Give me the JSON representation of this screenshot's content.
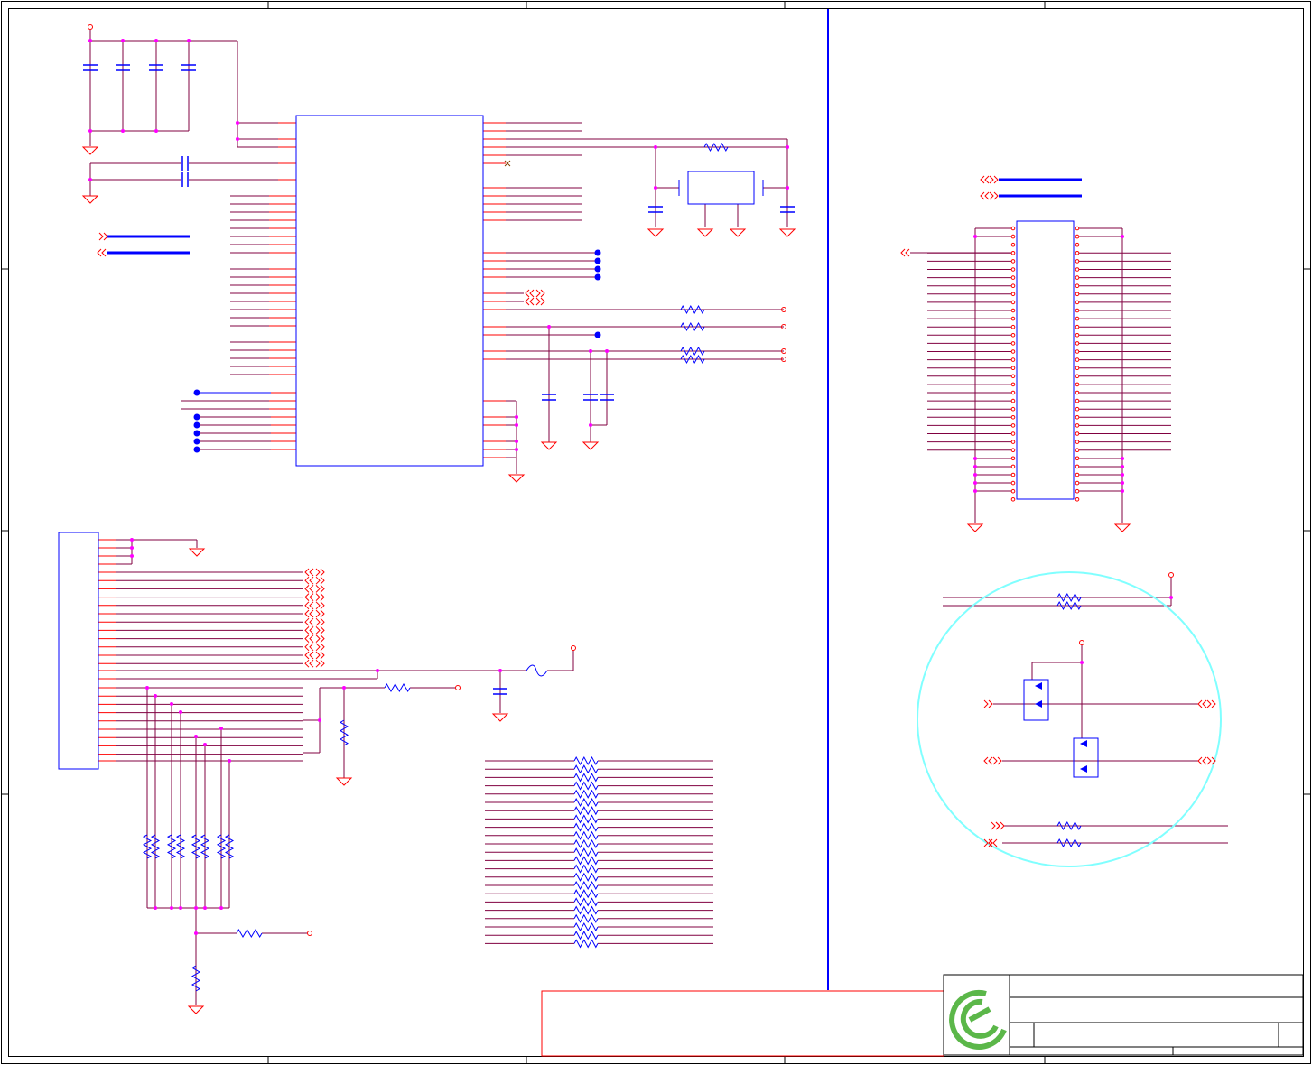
{
  "sheet": {
    "type": "schematic",
    "colors": {
      "wire": "#800040",
      "pin": "#ff0000",
      "component": "#0000ff",
      "junction": "#ff00ff",
      "highlight_circle": "#80ffff",
      "border": "#000000",
      "logo": "#5bb749"
    },
    "title_block": {
      "logo_icon": "green-e-logo"
    }
  }
}
